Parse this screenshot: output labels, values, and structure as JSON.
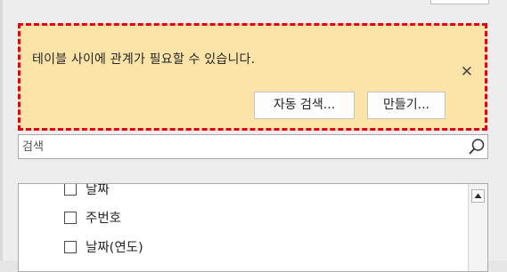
{
  "notice": {
    "message": "테이블 사이에 관계가 필요할 수 있습니다.",
    "close_icon": "close-icon",
    "auto_detect_label": "자동 검색...",
    "create_label": "만들기..."
  },
  "search": {
    "placeholder": "검색",
    "icon": "search-icon"
  },
  "field_list": {
    "items": [
      {
        "label": "날짜",
        "checked": false
      },
      {
        "label": "주번호",
        "checked": false
      },
      {
        "label": "날짜(연도)",
        "checked": false
      }
    ]
  },
  "colors": {
    "notice_bg": "#fce4a8",
    "highlight_border": "#e4001b"
  }
}
